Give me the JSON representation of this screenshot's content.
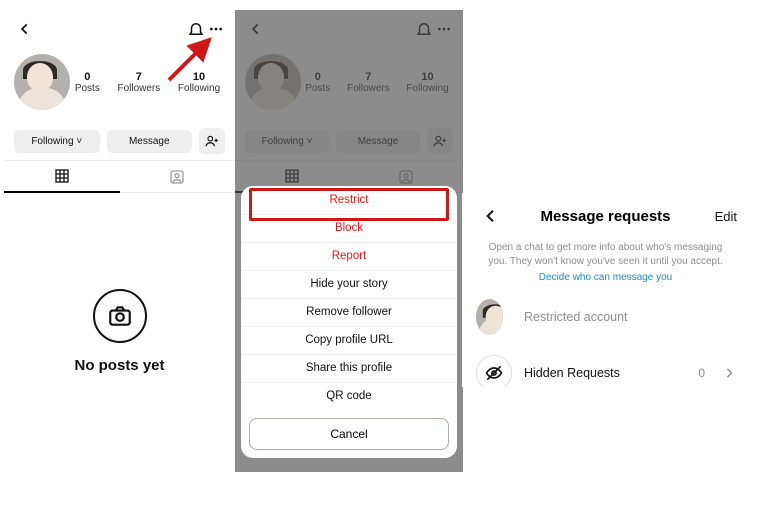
{
  "screen1": {
    "stats": {
      "posts": {
        "num": "0",
        "label": "Posts"
      },
      "followers": {
        "num": "7",
        "label": "Followers"
      },
      "following": {
        "num": "10",
        "label": "Following"
      }
    },
    "buttons": {
      "following": "Following ˅",
      "message": "Message"
    },
    "empty": {
      "text": "No posts yet"
    }
  },
  "screen2": {
    "menu": {
      "restrict": "Restrict",
      "block": "Block",
      "report": "Report",
      "hideStory": "Hide your story",
      "removeFollower": "Remove follower",
      "copyUrl": "Copy profile URL",
      "shareProfile": "Share this profile",
      "qr": "QR code",
      "cancel": "Cancel"
    }
  },
  "screen3": {
    "title": "Message requests",
    "edit": "Edit",
    "helper": "Open a chat to get more info about who's messaging you. They won't know you've seen it until you accept.",
    "helperLink": "Decide who can message you",
    "restrictedLabel": "Restricted account",
    "hiddenLabel": "Hidden Requests",
    "hiddenCount": "0"
  }
}
